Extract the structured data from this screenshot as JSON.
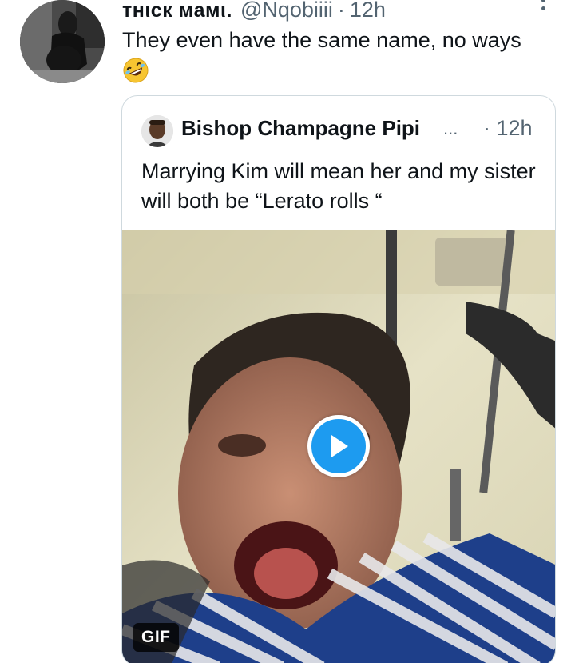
{
  "tweet": {
    "author_display_name": "тнιcк мaмι.",
    "author_handle": "@Nqobiiii",
    "separator": "·",
    "time": "12h",
    "text": "They even have the same name, no ways",
    "emoji_icon": "rolling-on-floor-laughing-emoji"
  },
  "quoted_tweet": {
    "author_name": "Bishop Champagne Pipi",
    "truncation": "...",
    "separator": "·",
    "time": "12h",
    "text": "Marrying Kim will mean her and my sister will both be “Lerato rolls “",
    "media": {
      "type": "gif",
      "badge_label": "GIF",
      "play_icon": "play-icon"
    }
  },
  "colors": {
    "text_primary": "#0f1419",
    "text_secondary": "#536471",
    "accent": "#1d9bf0",
    "border": "#cfd9de"
  }
}
